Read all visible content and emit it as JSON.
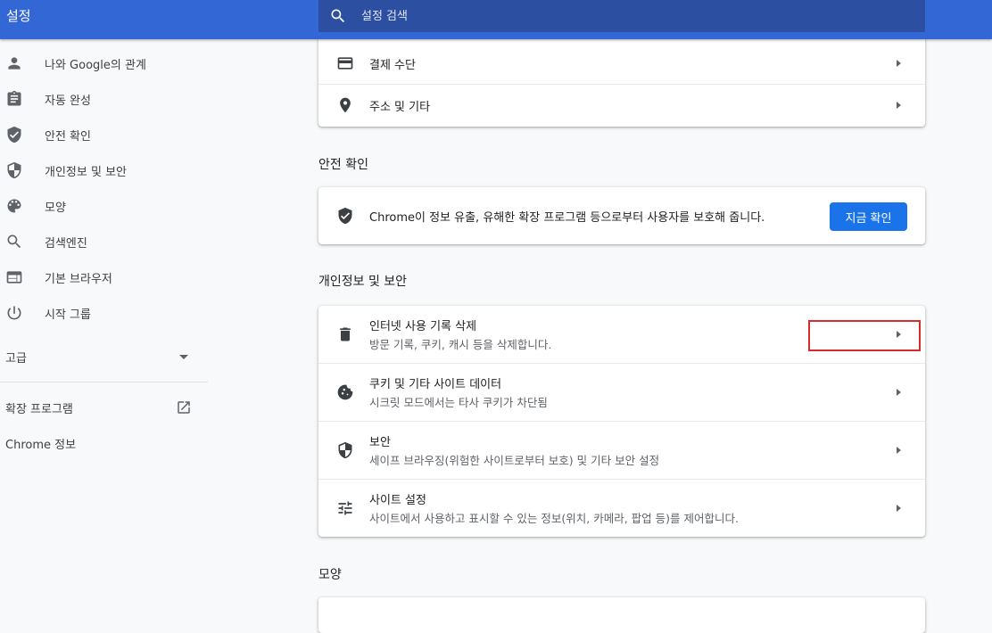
{
  "header": {
    "title": "설정"
  },
  "search": {
    "placeholder": "설정 검색"
  },
  "sidebar": {
    "items": [
      {
        "label": "나와 Google의 관계",
        "icon": "person-icon"
      },
      {
        "label": "자동 완성",
        "icon": "clipboard-icon"
      },
      {
        "label": "안전 확인",
        "icon": "shield-check-icon"
      },
      {
        "label": "개인정보 및 보안",
        "icon": "shield-half-icon"
      },
      {
        "label": "모양",
        "icon": "palette-icon"
      },
      {
        "label": "검색엔진",
        "icon": "search-icon"
      },
      {
        "label": "기본 브라우저",
        "icon": "browser-icon"
      },
      {
        "label": "시작 그룹",
        "icon": "power-icon"
      }
    ],
    "advanced": "고급",
    "extensions": "확장 프로그램",
    "about": "Chrome 정보"
  },
  "autofill_card": {
    "rows": [
      {
        "title": "결제 수단",
        "icon": "credit-card-icon"
      },
      {
        "title": "주소 및 기타",
        "icon": "location-pin-icon"
      }
    ]
  },
  "safety": {
    "section_title": "안전 확인",
    "text": "Chrome이 정보 유출, 유해한 확장 프로그램 등으로부터 사용자를 보호해 줍니다.",
    "button": "지금 확인"
  },
  "privacy": {
    "section_title": "개인정보 및 보안",
    "rows": [
      {
        "title": "인터넷 사용 기록 삭제",
        "subtitle": "방문 기록, 쿠키, 캐시 등을 삭제합니다.",
        "icon": "trash-icon"
      },
      {
        "title": "쿠키 및 기타 사이트 데이터",
        "subtitle": "시크릿 모드에서는 타사 쿠키가 차단됨",
        "icon": "cookie-icon"
      },
      {
        "title": "보안",
        "subtitle": "세이프 브라우징(위험한 사이트로부터 보호) 및 기타 보안 설정",
        "icon": "shield-half-icon"
      },
      {
        "title": "사이트 설정",
        "subtitle": "사이트에서 사용하고 표시할 수 있는 정보(위치, 카메라, 팝업 등)를 제어합니다.",
        "icon": "sliders-icon"
      }
    ]
  },
  "appearance": {
    "section_title": "모양"
  },
  "colors": {
    "header": "#3367d6",
    "accent": "#1a73e8",
    "highlight": "#d92b2b"
  }
}
